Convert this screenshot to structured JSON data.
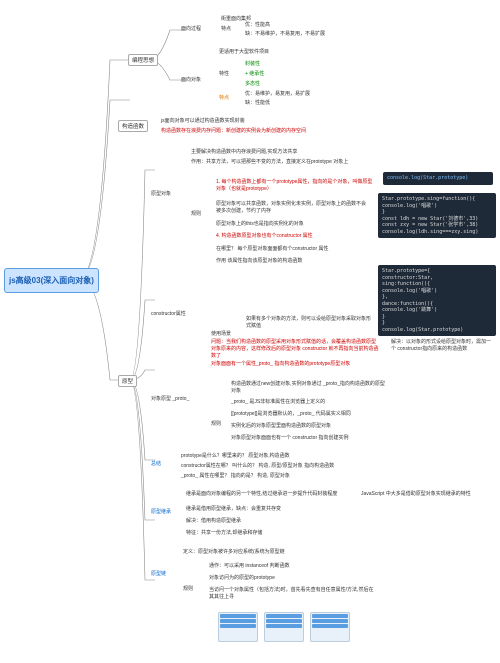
{
  "root": "js高级03(深入面向对象)",
  "b1": "编程思想",
  "b1a": "面向过程",
  "b1a1": "街重面向集邦",
  "b1a2": "特点",
  "b1a2a": "优：性能高",
  "b1a2b": "缺：不易维护，不易复用，不易扩展",
  "b1b": "面向对象",
  "b1b1": "更适用于大型软件项目",
  "b1b2": "特性",
  "b1b2a": "封装性",
  "b1b2b": "+ 继承性",
  "b1b2c": "多态性",
  "b1b3": "特点",
  "b1b3a": "优：易维护，易复用，易扩展",
  "b1b3b": "缺：性能低",
  "b2": "构造函数",
  "b2a": "js面向对象可以通过构造函数实现封装",
  "b2b": "构造函数存在浪费内存问题：新创建的实例会为新创建的内存空间",
  "b3": "原型",
  "b3a": "原型对象",
  "b3a1": "主要解决构造函数中内存浪费问题,实现方法共享",
  "b3a2": "作用：共享方法，可以把那些不变的方法，直接定义在prototype 对象上",
  "b3a3": "规则",
  "b3a3a": "1. 每个构造函数上都有一个prototype属性，指向的是个对象，叫做原型对象（也就是prototype）",
  "b3a3b": "原型对象可以共享函数，对象实例化未实例，原型对象上的函数不会被多次创建，节约了内存",
  "b3a3c": "原型对象上的this也是指向实例化的对象",
  "b3a3d": "4. 构造函数原型对象也有个constructor 属性",
  "b3a3e": "在哪里？ 每个原型对象面面都有个constructor 属性",
  "b3a3f": "作用 该属性指向该原型对象的构造函数",
  "b3b": "constructor属性",
  "b3b1": "使用场景",
  "b3b1a": "如果有多个对象的方法，则可以设给原型对象采取对象形式赋值",
  "b3b1b": "问题：当我们构造函数的原型采用对象形式赋值的话，会覆盖构造函数原型对象原来的内容，这样修改后的原型对象 constructor 就不再指向当前构造函数了",
  "b3b1c": "解决：以对象的形式设给原型对象时，需加一个 constructor指向原来的构造函数",
  "b3b1d": "对象面面有一个属性_proto_ 指向构造函数的prototype原型对象",
  "b3c": "对象原型 _proto_",
  "b3c1": "规则",
  "b3c1a": "构造函数通过new创建对象,实例对象通过 _proto_指向构造函数的原型对象",
  "b3c1b": "_proto_  是JS非标准属性在浏览器上定义的",
  "b3c1c": "[[prototype]]是浏览器默认的，_proto_ 代码属实义相同",
  "b3c1d": "实例化后的对象原型里面构造函数的原型对象",
  "b3c1e": "对象原型对象面面也有一个 constructor 指向创建实例",
  "b3d": "总结",
  "b3d1": "prototype是什么？哪里来的？   原型对象,构造函数",
  "b3d2": "constructor属性在哪？ 叫什么的？  构造, 原型/原型对象  指向构造函数",
  "b3d3": "_proto_ 属性在哪里？ 指向的是？  构造, 原型对象",
  "b3e": "原型继承",
  "b3e1": "继承是面向对象编程的另一个特性,结过继承进一步提升代码封装程度",
  "b3e1a": "JavaScript 中大多是借助原型对象实现继承的特性",
  "b3e2": "继承是借用原型继承，缺点：会重复共存变",
  "b3e3": "解决：借用构造原型继承",
  "b3e4": "特征：共享一份方法,却继承和存储",
  "b3f": "原型链",
  "b3f1": "定义：原型对象被许多对应系统(系统为原型链",
  "b3f2": "规则",
  "b3f2a": "通作：可以采用 instanceof 判断函数",
  "b3f2b": "对象访问为的原型的prototype",
  "b3f2c": "当访问一个对象属性（包括方法)时，首先看先查有自任意属性/方法,然后在其其往上寻",
  "code1_l1": "console.log(Star.prototype)",
  "code2_l1": "Star.prototype.sing=function(){",
  "code2_l2": "  console.log('唱歌')",
  "code2_l3": "}",
  "code2_l4": "const ldh = new Star('刘德市',33)",
  "code2_l5": "const zxy = new Star('张学市',38)",
  "code2_l6": "console.log(ldh.sing===zxy.sing)",
  "code3_l1": "Star.prototype={",
  "code3_l2": "  constructor:Star,",
  "code3_l3": "  sing:function(){",
  "code3_l4": "    console.log('唱歌')",
  "code3_l5": "  },",
  "code3_l6": "  dance:function(){",
  "code3_l7": "    console.log('跳舞')",
  "code3_l8": "  }",
  "code3_l9": "}",
  "code3_l10": "console.log(Star.prototype)"
}
